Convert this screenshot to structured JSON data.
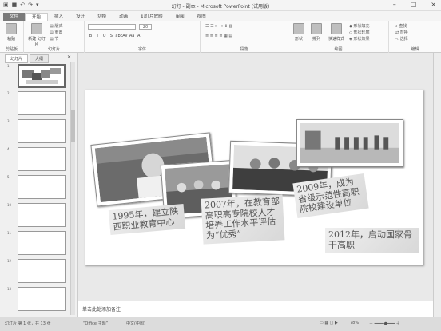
{
  "window": {
    "title": "幻灯 - 副本 - Microsoft PowerPoint (试用版)",
    "controls": [
      "–",
      "□",
      "×"
    ]
  },
  "tabs": [
    "文件",
    "开始",
    "插入",
    "设计",
    "切换",
    "动画",
    "幻灯片放映",
    "审阅",
    "视图"
  ],
  "ribbon": {
    "clipboard": {
      "paste": "粘贴",
      "label": "剪贴板"
    },
    "slides": {
      "new_slide": "新建\n幻灯片",
      "layout": "版式",
      "reset": "重置",
      "section": "节",
      "label": "幻灯片"
    },
    "font": {
      "size": "20",
      "label": "字体",
      "format": [
        "B",
        "I",
        "U",
        "S",
        "abc",
        "AV",
        "Aa",
        "A"
      ]
    },
    "paragraph": {
      "label": "段落"
    },
    "drawing": {
      "shapes": "形状",
      "arrange": "排列",
      "quick_styles": "快速样式",
      "fill": "形状填充",
      "outline": "形状轮廓",
      "effects": "形状效果",
      "label": "绘图"
    },
    "editing": {
      "find": "查找",
      "replace": "替换",
      "select": "选择",
      "label": "编辑"
    }
  },
  "panel": {
    "tabs": [
      "幻灯片",
      "大纲"
    ],
    "slide_numbers": [
      "1",
      "2",
      "3",
      "4",
      "5",
      "10",
      "11",
      "12",
      "13"
    ]
  },
  "slide": {
    "captions": [
      "1995年，建立陕西职业教育中心",
      "2007年，在教育部高职高专院校人才培养工作水平评估为“优秀”",
      "2009年，成为省级示范性高职院校建设单位",
      "2012年，启动国家骨干高职"
    ]
  },
  "notes": {
    "placeholder": "单击此处添加备注"
  },
  "status": {
    "slide_info": "幻灯片 第 1 张，共 13 张",
    "theme": "“Office 主题”",
    "language": "中文(中国)",
    "zoom": "78%"
  }
}
